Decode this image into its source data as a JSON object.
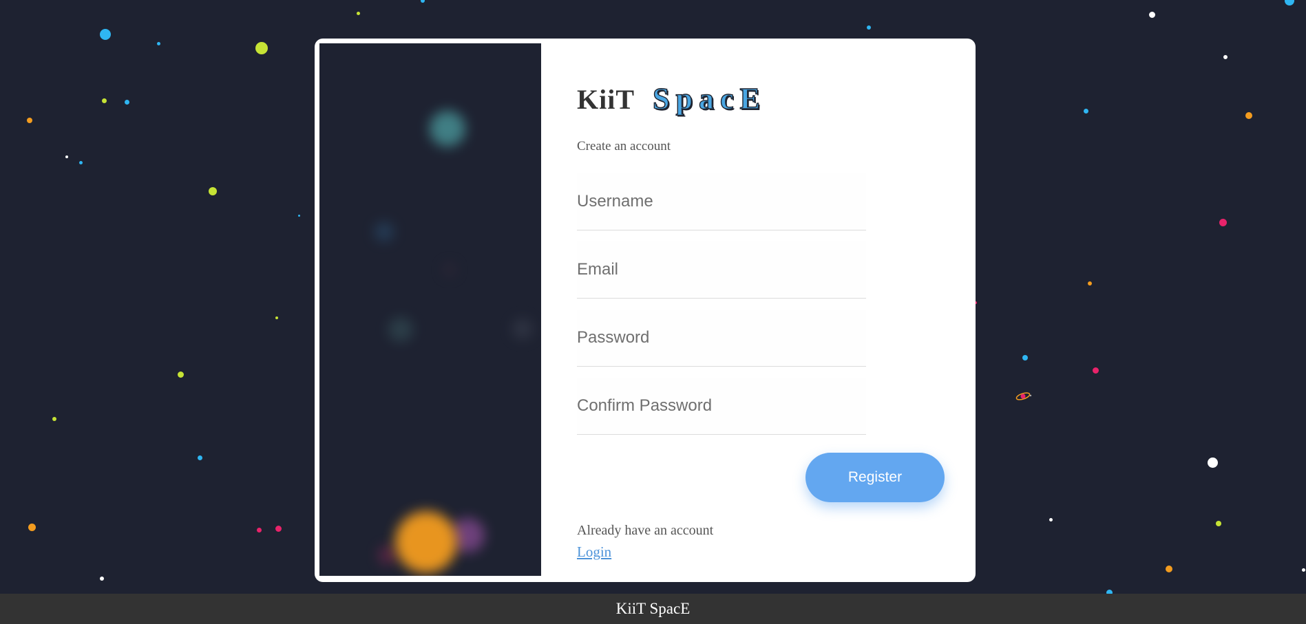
{
  "colors": {
    "background": "#1e2231",
    "card": "#ffffff",
    "brand_accent": "#4aa6e2",
    "button": "#63a7f0",
    "link": "#4d93d9",
    "footer": "#333333"
  },
  "brand": {
    "part1": "KiiT",
    "part2": "SpacE"
  },
  "form": {
    "subtitle": "Create an account",
    "username_placeholder": "Username",
    "email_placeholder": "Email",
    "password_placeholder": "Password",
    "confirm_password_placeholder": "Confirm Password",
    "register_label": "Register",
    "already_text": "Already have an account",
    "login_label": "Login"
  },
  "footer": {
    "text": "KiiT SpacE"
  },
  "icons": {
    "background": "star-field",
    "planet": "ringed-planet-icon"
  }
}
